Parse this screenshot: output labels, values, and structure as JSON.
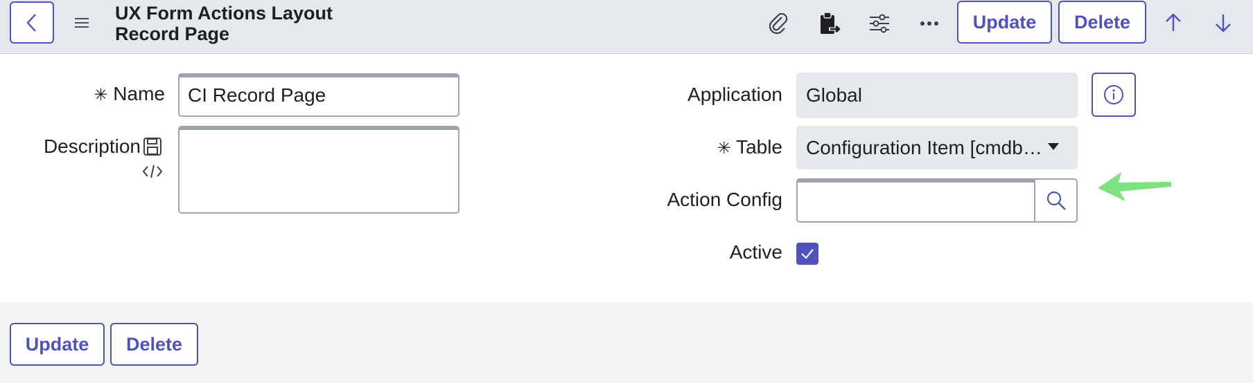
{
  "header": {
    "title_line1": "UX Form Actions Layout",
    "title_line2": "Record Page",
    "update_label": "Update",
    "delete_label": "Delete"
  },
  "form": {
    "name_label": "Name",
    "name_value": "CI Record Page",
    "description_label": "Description",
    "description_value": "",
    "application_label": "Application",
    "application_value": "Global",
    "table_label": "Table",
    "table_value": "Configuration Item [cmdb…",
    "action_config_label": "Action Config",
    "action_config_value": "",
    "active_label": "Active",
    "active_checked": true,
    "required_marker": "✳"
  },
  "footer": {
    "update_label": "Update",
    "delete_label": "Delete"
  },
  "colors": {
    "accent": "#4f52bd",
    "header_bg": "#e5e8ec",
    "annotation_arrow": "#7ee27e"
  }
}
